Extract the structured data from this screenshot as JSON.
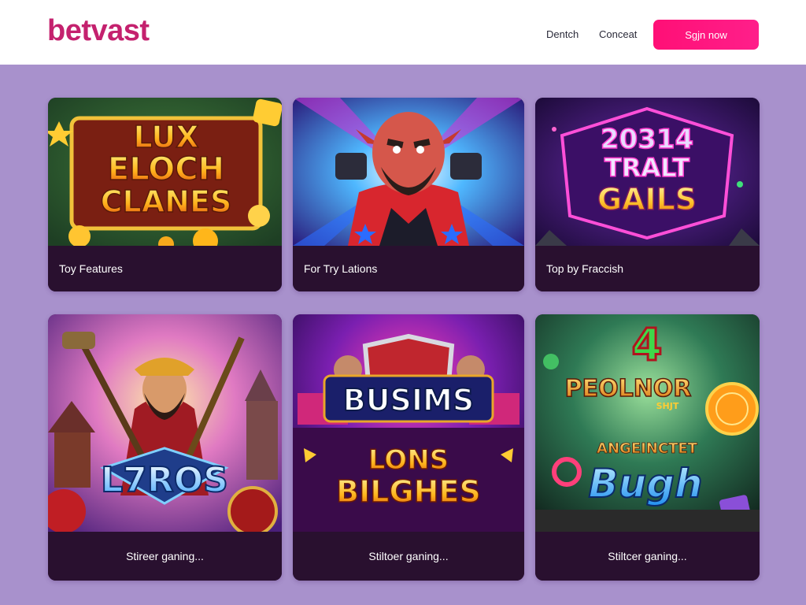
{
  "header": {
    "logo": "betvast",
    "nav": [
      "Dentch",
      "Conceat"
    ],
    "signin_label": "Sgjn now"
  },
  "colors": {
    "page_bg": "#a891cc",
    "brand": "#c4216e",
    "signin_bg": "#ff1f8a",
    "card_label_bg": "#29102f"
  },
  "cards": [
    {
      "title_lines": [
        "LUX",
        "ELOCH",
        "CLANES"
      ],
      "label": "Toy Features",
      "art": "gold-coins-slot-art"
    },
    {
      "title_lines": [],
      "label": "For Try Lations",
      "art": "red-goblin-character-art"
    },
    {
      "title_lines": [
        "20314",
        "TRALT",
        "GAILS"
      ],
      "label": "Top by Fraccish",
      "art": "neon-purple-gem-art"
    },
    {
      "title_lines": [
        "L7ROS"
      ],
      "label": "Stireer ganing...",
      "art": "warrior-temple-art"
    },
    {
      "title_lines": [
        "BUSIMS",
        "LONS",
        "BILGHES"
      ],
      "label": "Stiltoer ganing...",
      "art": "shield-heroes-art"
    },
    {
      "title_lines": [
        "4",
        "PEOLNOR",
        "SHJT",
        "ANGEINCTET",
        "Bugh"
      ],
      "label": "Stiltcer ganing...",
      "art": "fruit-candy-slot-art"
    }
  ]
}
